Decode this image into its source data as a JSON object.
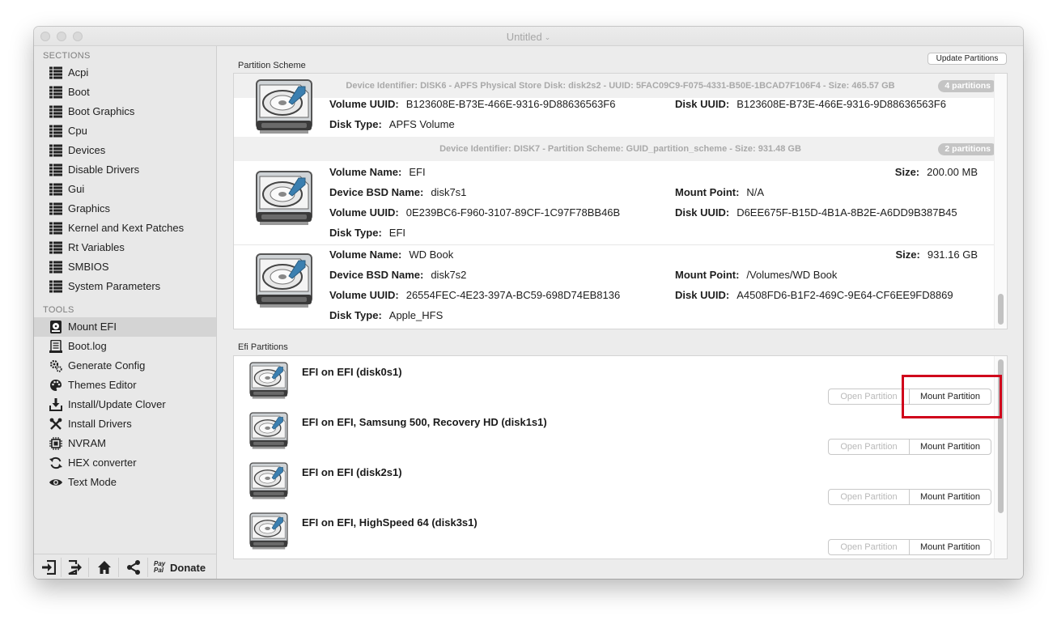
{
  "window": {
    "title": "Untitled",
    "title_chevron": "⌄"
  },
  "sidebar": {
    "sections_heading": "SECTIONS",
    "sections": [
      {
        "label": "Acpi",
        "icon": "list-icon"
      },
      {
        "label": "Boot",
        "icon": "list-icon"
      },
      {
        "label": "Boot Graphics",
        "icon": "list-icon"
      },
      {
        "label": "Cpu",
        "icon": "list-icon"
      },
      {
        "label": "Devices",
        "icon": "list-icon"
      },
      {
        "label": "Disable Drivers",
        "icon": "list-icon"
      },
      {
        "label": "Gui",
        "icon": "list-icon"
      },
      {
        "label": "Graphics",
        "icon": "list-icon"
      },
      {
        "label": "Kernel and Kext Patches",
        "icon": "list-icon"
      },
      {
        "label": "Rt Variables",
        "icon": "list-icon"
      },
      {
        "label": "SMBIOS",
        "icon": "list-icon"
      },
      {
        "label": "System Parameters",
        "icon": "list-icon"
      }
    ],
    "tools_heading": "TOOLS",
    "tools": [
      {
        "label": "Mount EFI",
        "icon": "drive-icon",
        "selected": true
      },
      {
        "label": "Boot.log",
        "icon": "log-icon"
      },
      {
        "label": "Generate Config",
        "icon": "gears-icon"
      },
      {
        "label": "Themes Editor",
        "icon": "palette-icon"
      },
      {
        "label": "Install/Update Clover",
        "icon": "download-icon"
      },
      {
        "label": "Install Drivers",
        "icon": "tools-icon"
      },
      {
        "label": "NVRAM",
        "icon": "chip-icon"
      },
      {
        "label": "HEX converter",
        "icon": "refresh-icon"
      },
      {
        "label": "Text Mode",
        "icon": "eye-icon"
      }
    ],
    "bottom": {
      "paypal_line1": "Pay",
      "paypal_line2": "Pal",
      "donate_label": "Donate"
    }
  },
  "partition_scheme": {
    "label": "Partition Scheme",
    "update_button": "Update Partitions",
    "disks": [
      {
        "header": "Device Identifier: DISK6 - APFS Physical Store Disk: disk2s2 - UUID: 5FAC09C9-F075-4331-B50E-1BCAD7F106F4 - Size: 465.57 GB",
        "badge": "4 partitions",
        "volumes": [
          {
            "volume_uuid_key": "Volume UUID:",
            "volume_uuid": "B123608E-B73E-466E-9316-9D88636563F6",
            "disk_uuid_key": "Disk UUID:",
            "disk_uuid": "B123608E-B73E-466E-9316-9D88636563F6",
            "disk_type_key": "Disk Type:",
            "disk_type": "APFS Volume"
          }
        ]
      },
      {
        "header": "Device Identifier: DISK7 - Partition Scheme: GUID_partition_scheme - Size: 931.48 GB",
        "badge": "2 partitions",
        "volumes": [
          {
            "volume_name_key": "Volume Name:",
            "volume_name": "EFI",
            "size_key": "Size:",
            "size": "200.00 MB",
            "bsd_key": "Device BSD Name:",
            "bsd": "disk7s1",
            "mount_key": "Mount Point:",
            "mount": "N/A",
            "volume_uuid_key": "Volume UUID:",
            "volume_uuid": "0E239BC6-F960-3107-89CF-1C97F78BB46B",
            "disk_uuid_key": "Disk UUID:",
            "disk_uuid": "D6EE675F-B15D-4B1A-8B2E-A6DD9B387B45",
            "disk_type_key": "Disk Type:",
            "disk_type": "EFI"
          },
          {
            "volume_name_key": "Volume Name:",
            "volume_name": "WD Book",
            "size_key": "Size:",
            "size": "931.16 GB",
            "bsd_key": "Device BSD Name:",
            "bsd": "disk7s2",
            "mount_key": "Mount Point:",
            "mount": "/Volumes/WD Book",
            "volume_uuid_key": "Volume UUID:",
            "volume_uuid": "26554FEC-4E23-397A-BC59-698D74EB8136",
            "disk_uuid_key": "Disk UUID:",
            "disk_uuid": "A4508FD6-B1F2-469C-9E64-CF6EE9FD8869",
            "disk_type_key": "Disk Type:",
            "disk_type": "Apple_HFS"
          }
        ]
      }
    ]
  },
  "efi_partitions": {
    "label": "Efi Partitions",
    "open_label": "Open Partition",
    "mount_label": "Mount Partition",
    "rows": [
      {
        "title": "EFI on EFI (disk0s1)"
      },
      {
        "title": "EFI on EFI, Samsung 500, Recovery HD (disk1s1)"
      },
      {
        "title": "EFI on EFI (disk2s1)"
      },
      {
        "title": "EFI on EFI, HighSpeed 64 (disk3s1)"
      }
    ]
  },
  "colors": {
    "highlight": "#d0021b",
    "selected_bg": "#d4d4d4",
    "badge_bg": "#c4c4c4"
  }
}
